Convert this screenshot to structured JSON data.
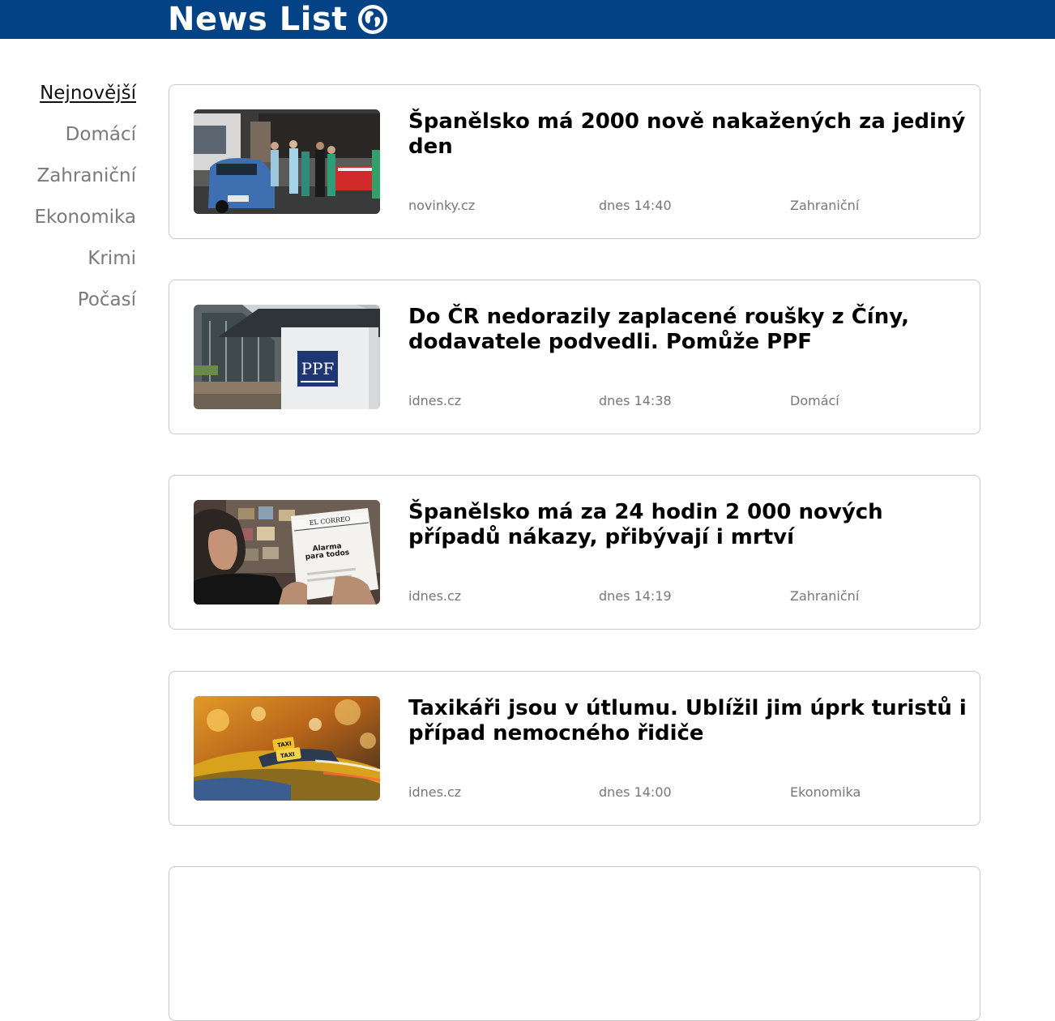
{
  "header": {
    "title": "News List",
    "icon": "globe-icon",
    "background_color": "#034385"
  },
  "sidebar": {
    "items": [
      {
        "label": "Nejnovější",
        "active": true
      },
      {
        "label": "Domácí",
        "active": false
      },
      {
        "label": "Zahraniční",
        "active": false
      },
      {
        "label": "Ekonomika",
        "active": false
      },
      {
        "label": "Krimi",
        "active": false
      },
      {
        "label": "Počasí",
        "active": false
      }
    ]
  },
  "articles": [
    {
      "title": "Španělsko má 2000 nově nakažených za jediný den",
      "source": "novinky.cz",
      "time": "dnes 14:40",
      "category": "Zahraniční",
      "image": "medical-workers-street-photo"
    },
    {
      "title": "Do ČR nedorazily zaplacené roušky z Číny, dodavatele podvedli. Pomůže PPF",
      "source": "idnes.cz",
      "time": "dnes 14:38",
      "category": "Domácí",
      "image": "ppf-building-photo",
      "image_text": "PPF"
    },
    {
      "title": "Španělsko má za 24 hodin 2 000 nových případů nákazy, přibývají i mrtví",
      "source": "idnes.cz",
      "time": "dnes 14:19",
      "category": "Zahraniční",
      "image": "man-reading-newspaper-photo",
      "image_text": [
        "EL CORREO",
        "Alarma",
        "para todos"
      ]
    },
    {
      "title": "Taxikáři jsou v útlumu. Ublížil jim úprk turistů i případ nemocného řidiče",
      "source": "idnes.cz",
      "time": "dnes 14:00",
      "category": "Ekonomika",
      "image": "taxi-sign-photo",
      "image_text": [
        "TAXI",
        "TAXI"
      ]
    }
  ]
}
